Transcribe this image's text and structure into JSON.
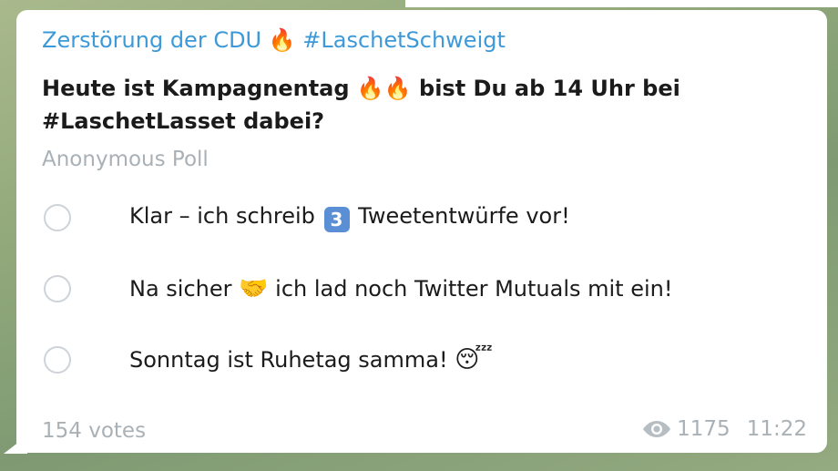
{
  "post": {
    "channel_title": "Zerstörung der CDU 🔥 #LaschetSchweigt",
    "question": "Heute ist Kampagnentag 🔥🔥 bist Du ab 14 Uhr bei #LaschetLasset dabei?",
    "poll_type": "Anonymous Poll"
  },
  "poll": {
    "options": [
      {
        "before": "Klar – ich schreib ",
        "icon": "3",
        "after": " Tweetentwürfe vor!"
      },
      {
        "before": "Na sicher ",
        "icon": "🤝",
        "after": " ich lad noch Twitter Mutuals mit ein!"
      },
      {
        "before": "Sonntag ist Ruhetag samma! ",
        "icon": "😴",
        "after": ""
      }
    ],
    "votes_label": "154 votes"
  },
  "footer": {
    "views": "1175",
    "time": "11:22"
  },
  "icons": {
    "views": "eye-icon",
    "option_1": "keycap-three-icon",
    "option_2": "handshake-icon",
    "option_3": "sleeping-face-icon"
  },
  "colors": {
    "channel_link": "#3d99d8",
    "muted": "#a9b1b6",
    "radio_border": "#cdd3d8",
    "text": "#1b1b1b"
  }
}
